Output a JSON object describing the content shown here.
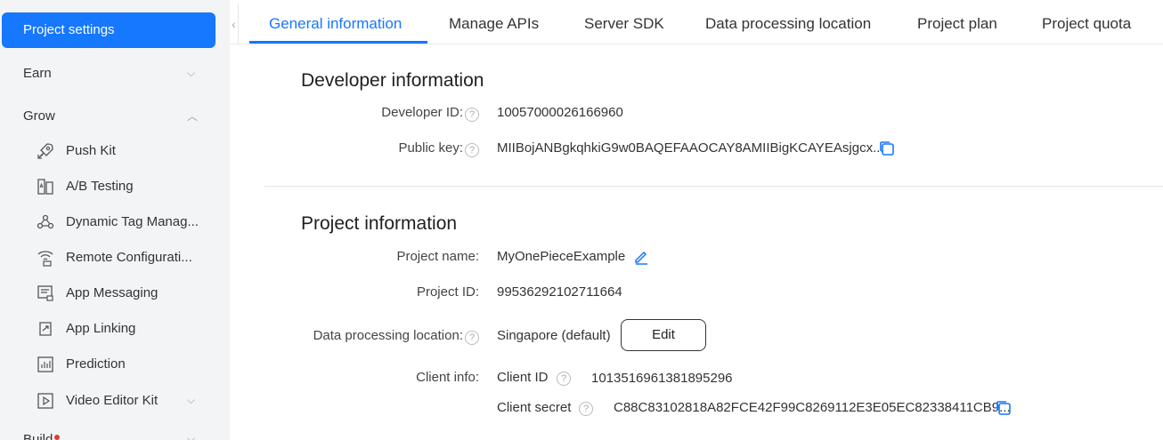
{
  "sidebar": {
    "active_label": "Project settings",
    "earn_label": "Earn",
    "grow_label": "Grow",
    "items": [
      {
        "label": "Push Kit",
        "icon": "rocket-icon"
      },
      {
        "label": "A/B Testing",
        "icon": "ab-testing-icon"
      },
      {
        "label": "Dynamic Tag Manag...",
        "icon": "tag-manager-icon"
      },
      {
        "label": "Remote Configurati...",
        "icon": "remote-config-icon"
      },
      {
        "label": "App Messaging",
        "icon": "app-messaging-icon"
      },
      {
        "label": "App Linking",
        "icon": "app-linking-icon"
      },
      {
        "label": "Prediction",
        "icon": "prediction-icon"
      },
      {
        "label": "Video Editor Kit",
        "icon": "video-editor-icon"
      }
    ],
    "build_label": "Build"
  },
  "tabs": [
    {
      "label": "General information",
      "active": true
    },
    {
      "label": "Manage APIs"
    },
    {
      "label": "Server SDK"
    },
    {
      "label": "Data processing location"
    },
    {
      "label": "Project plan"
    },
    {
      "label": "Project quota"
    }
  ],
  "developer": {
    "title": "Developer information",
    "id_label": "Developer ID:",
    "id_value": "10057000026166960",
    "key_label": "Public key:",
    "key_value": "MIIBojANBgkqhkiG9w0BAQEFAAOCAY8AMIIBigKCAYEAsjgcx..."
  },
  "project": {
    "title": "Project information",
    "name_label": "Project name:",
    "name_value": "MyOnePieceExample",
    "id_label": "Project ID:",
    "id_value": "99536292102711664",
    "location_label": "Data processing location:",
    "location_value": "Singapore (default)",
    "edit_label": "Edit",
    "client_label": "Client info:",
    "client_id_label": "Client ID",
    "client_id_value": "1013516961381895296",
    "client_secret_label": "Client secret",
    "client_secret_value": "C88C83102818A82FCE42F99C8269112E3E05EC82338411CB9..."
  },
  "colors": {
    "accent": "#1677ff",
    "sidebar_bg": "#f3f4f6"
  }
}
